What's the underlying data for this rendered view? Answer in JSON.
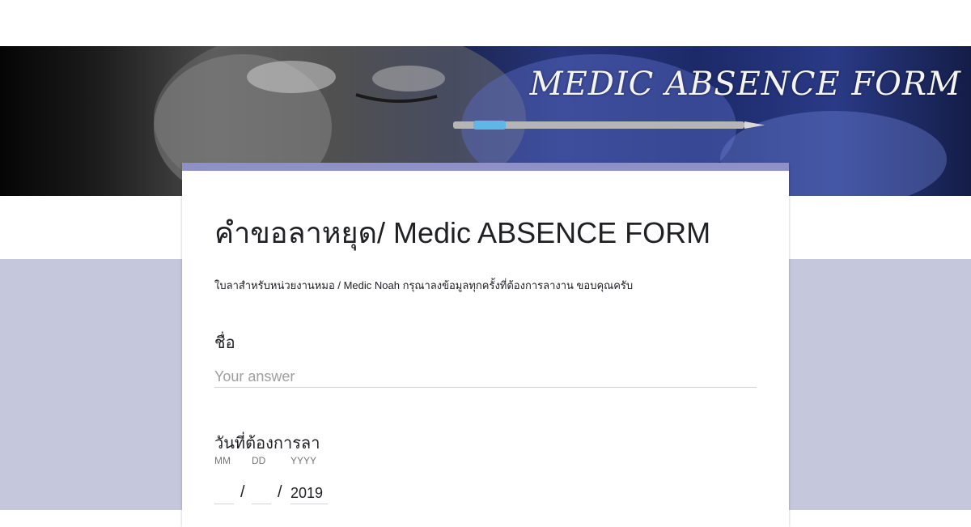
{
  "banner": {
    "title": "MEDIC ABSENCE FORM",
    "accent_color": "#8f90c8"
  },
  "form": {
    "title": "คำขอลาหยุด/ Medic ABSENCE FORM",
    "description": "ใบลาสำหรับหน่วยงานหมอ / Medic Noah กรุณาลงข้อมูลทุกครั้งที่ต้องการลางาน ขอบคุณครับ"
  },
  "questions": [
    {
      "label": "ชื่อ",
      "placeholder": "Your answer",
      "value": ""
    },
    {
      "label": "วันที่ต้องการลา",
      "date": {
        "month_caption": "MM",
        "day_caption": "DD",
        "year_caption": "YYYY",
        "month_value": "",
        "day_value": "",
        "year_value": "2019",
        "separator": "/"
      }
    }
  ],
  "colors": {
    "page_lower_bg": "#c5c7dc",
    "card_bg": "#ffffff",
    "card_border": "#8f90c8"
  }
}
